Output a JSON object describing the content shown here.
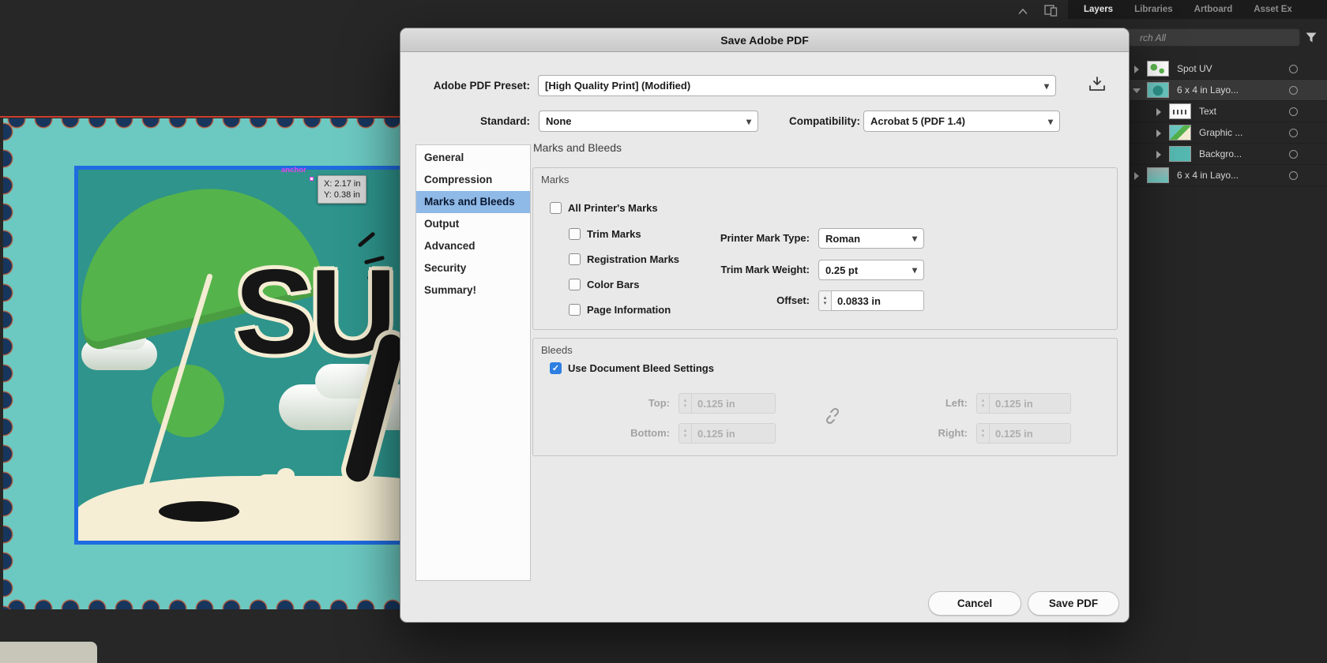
{
  "colors": {
    "accent_blue": "#2d7ee2",
    "sidebar_selection": "#8fb9e6",
    "stamp_teal": "#6cc9c2",
    "stamp_inner_teal": "#2e948c",
    "stamp_border_blue": "#1f6be0",
    "scallop_navy": "#16365e",
    "scallop_orange": "#bf4f2e",
    "umbrella_green": "#55b34b",
    "cream": "#f5eed4"
  },
  "icons": {
    "chevron_down": "▾",
    "stepper_up": "▴",
    "stepper_down": "▾",
    "check": "✓"
  },
  "canvas": {
    "anchor_label": "anchor",
    "tooltip": {
      "x": "X: 2.17 in",
      "y": "Y: 0.38 in"
    },
    "artwork_text": "SU"
  },
  "layers_panel": {
    "tabs": [
      {
        "label": "Layers",
        "active": true
      },
      {
        "label": "Libraries",
        "active": false
      },
      {
        "label": "Artboard",
        "active": false
      },
      {
        "label": "Asset Ex",
        "active": false
      }
    ],
    "search_text": "rch All",
    "layers": [
      {
        "name": "Spot UV"
      },
      {
        "name": "6 x 4 in Layo..."
      },
      {
        "name": "Text"
      },
      {
        "name": "Graphic ..."
      },
      {
        "name": "Backgro..."
      },
      {
        "name": "6 x 4 in Layo..."
      }
    ]
  },
  "dialog": {
    "title": "Save Adobe PDF",
    "preset": {
      "label": "Adobe PDF Preset:",
      "value": "[High Quality Print] (Modified)"
    },
    "standard": {
      "label": "Standard:",
      "value": "None"
    },
    "compatibility": {
      "label": "Compatibility:",
      "value": "Acrobat 5 (PDF 1.4)"
    },
    "sections": [
      "General",
      "Compression",
      "Marks and Bleeds",
      "Output",
      "Advanced",
      "Security",
      "Summary!"
    ],
    "active_section": "Marks and Bleeds",
    "panel_title": "Marks and Bleeds",
    "marks": {
      "title": "Marks",
      "checkboxes": [
        {
          "label": "All Printer's Marks",
          "checked": false
        },
        {
          "label": "Trim Marks",
          "checked": false
        },
        {
          "label": "Registration Marks",
          "checked": false
        },
        {
          "label": "Color Bars",
          "checked": false
        },
        {
          "label": "Page Information",
          "checked": false
        }
      ],
      "printer_mark_type": {
        "label": "Printer Mark Type:",
        "value": "Roman"
      },
      "trim_mark_weight": {
        "label": "Trim Mark Weight:",
        "value": "0.25 pt"
      },
      "offset": {
        "label": "Offset:",
        "value": "0.0833 in"
      }
    },
    "bleeds": {
      "title": "Bleeds",
      "use_document": {
        "label": "Use Document Bleed Settings",
        "checked": true
      },
      "top": {
        "label": "Top:",
        "value": "0.125 in"
      },
      "bottom": {
        "label": "Bottom:",
        "value": "0.125 in"
      },
      "left": {
        "label": "Left:",
        "value": "0.125 in"
      },
      "right": {
        "label": "Right:",
        "value": "0.125 in"
      }
    },
    "buttons": {
      "cancel": "Cancel",
      "save": "Save PDF"
    }
  }
}
